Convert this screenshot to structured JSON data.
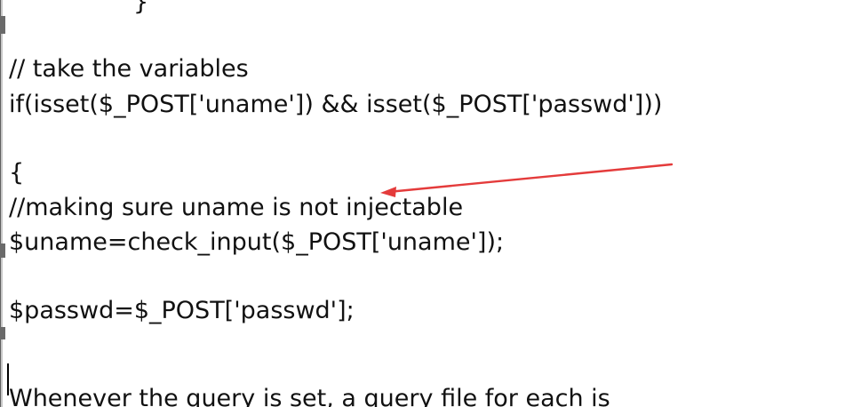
{
  "code": {
    "lines": [
      "}",
      "// take the variables",
      "if(isset($_POST['uname']) && isset($_POST['passwd']))",
      "{",
      "//making sure uname is not injectable",
      "$uname=check_input($_POST['uname']);",
      "$passwd=$_POST['passwd'];",
      "Whenever the query is set, a query file for each is"
    ]
  },
  "annotation": {
    "arrow_color": "#e43b3b",
    "arrow_icon": "annotation-arrow-icon"
  },
  "colors": {
    "text": "#111111",
    "background": "#ffffff"
  }
}
